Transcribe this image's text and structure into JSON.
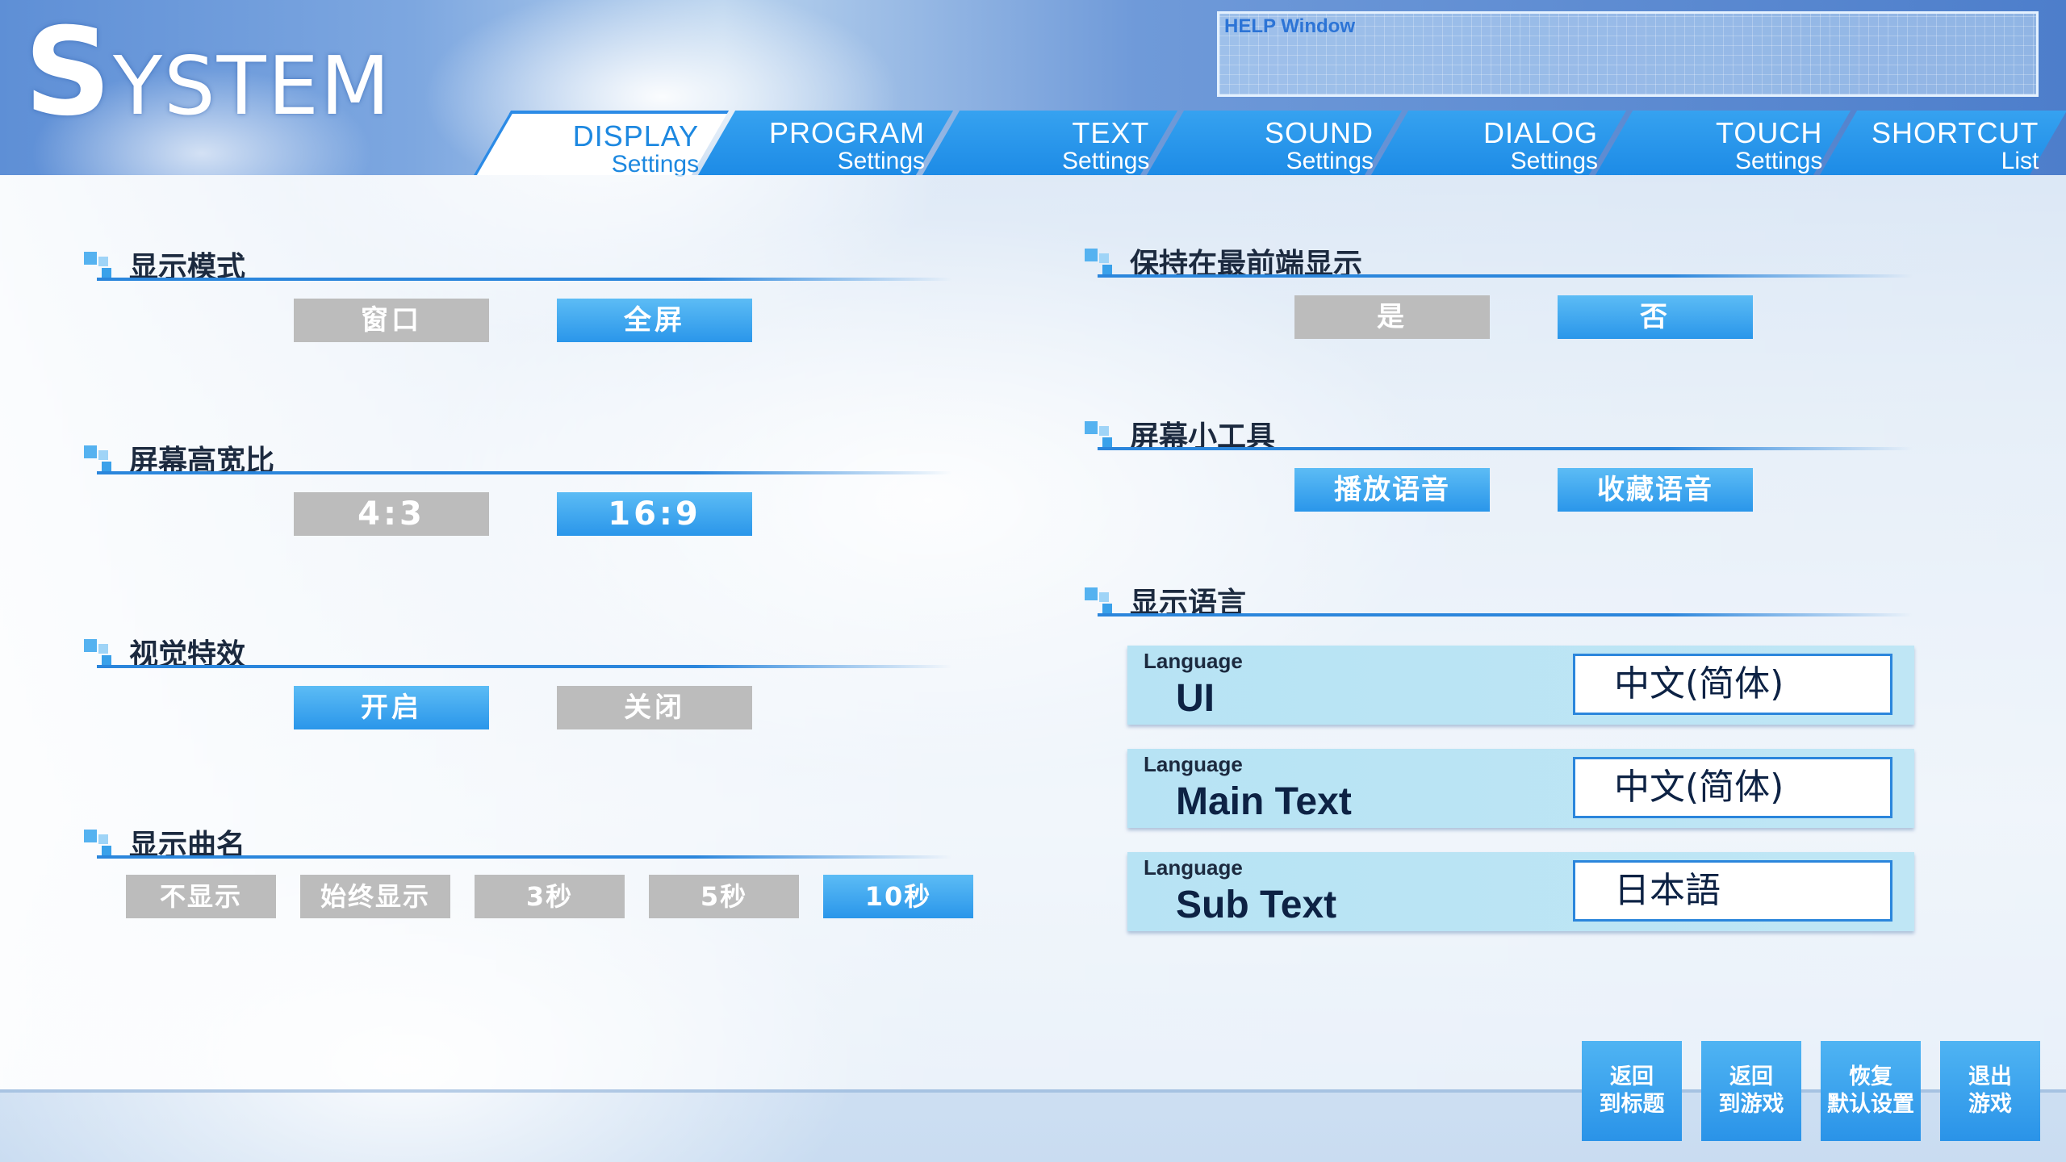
{
  "header": {
    "title_first": "S",
    "title_rest": "YSTEM",
    "help_title": "HELP Window"
  },
  "tabs": [
    {
      "main": "DISPLAY",
      "sub": "Settings",
      "active": true
    },
    {
      "main": "PROGRAM",
      "sub": "Settings",
      "active": false
    },
    {
      "main": "TEXT",
      "sub": "Settings",
      "active": false
    },
    {
      "main": "SOUND",
      "sub": "Settings",
      "active": false
    },
    {
      "main": "DIALOG",
      "sub": "Settings",
      "active": false
    },
    {
      "main": "TOUCH",
      "sub": "Settings",
      "active": false
    },
    {
      "main": "SHORTCUT",
      "sub": "List",
      "active": false
    }
  ],
  "left": {
    "display_mode": {
      "title": "显示模式",
      "options": [
        "窗口",
        "全屏"
      ],
      "selected": 1
    },
    "aspect_ratio": {
      "title": "屏幕高宽比",
      "options": [
        "4:3",
        "16:9"
      ],
      "selected": 1
    },
    "visual_effects": {
      "title": "视觉特效",
      "options": [
        "开启",
        "关闭"
      ],
      "selected": 0
    },
    "song_name": {
      "title": "显示曲名",
      "options": [
        "不显示",
        "始终显示",
        "3秒",
        "5秒",
        "10秒"
      ],
      "selected": 4
    }
  },
  "right": {
    "always_on_top": {
      "title": "保持在最前端显示",
      "options": [
        "是",
        "否"
      ],
      "selected": 1
    },
    "widgets": {
      "title": "屏幕小工具",
      "options": [
        "播放语音",
        "收藏语音"
      ]
    },
    "language": {
      "title": "显示语言",
      "rows": [
        {
          "label": "Language",
          "name": "UI",
          "value": "中文(简体)"
        },
        {
          "label": "Language",
          "name": "Main Text",
          "value": "中文(简体)"
        },
        {
          "label": "Language",
          "name": "Sub Text",
          "value": "日本語"
        }
      ]
    }
  },
  "bottom_buttons": [
    {
      "line1": "返回",
      "line2": "到标题"
    },
    {
      "line1": "返回",
      "line2": "到游戏"
    },
    {
      "line1": "恢复",
      "line2": "默认设置"
    },
    {
      "line1": "退出",
      "line2": "游戏"
    }
  ],
  "colors": {
    "accent": "#2a96ea",
    "tab_active_text": "#1d88e0",
    "inactive_option": "#bcbcbc"
  }
}
